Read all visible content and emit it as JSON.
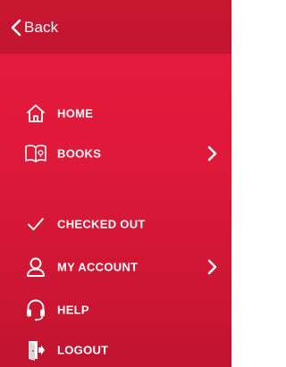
{
  "header": {
    "back_label": "Back"
  },
  "menu": {
    "items": [
      {
        "label": "HOME",
        "icon": "home-icon",
        "has_submenu": false
      },
      {
        "label": "BOOKS",
        "icon": "book-icon",
        "has_submenu": true
      },
      {
        "label": "CHECKED OUT",
        "icon": "checkmark-icon",
        "has_submenu": false
      },
      {
        "label": "MY ACCOUNT",
        "icon": "user-icon",
        "has_submenu": true
      },
      {
        "label": "HELP",
        "icon": "headset-icon",
        "has_submenu": false
      },
      {
        "label": "LOGOUT",
        "icon": "logout-icon",
        "has_submenu": false
      }
    ]
  },
  "colors": {
    "background": "#e01a3b",
    "header": "#c51631",
    "text": "#ffffff"
  }
}
